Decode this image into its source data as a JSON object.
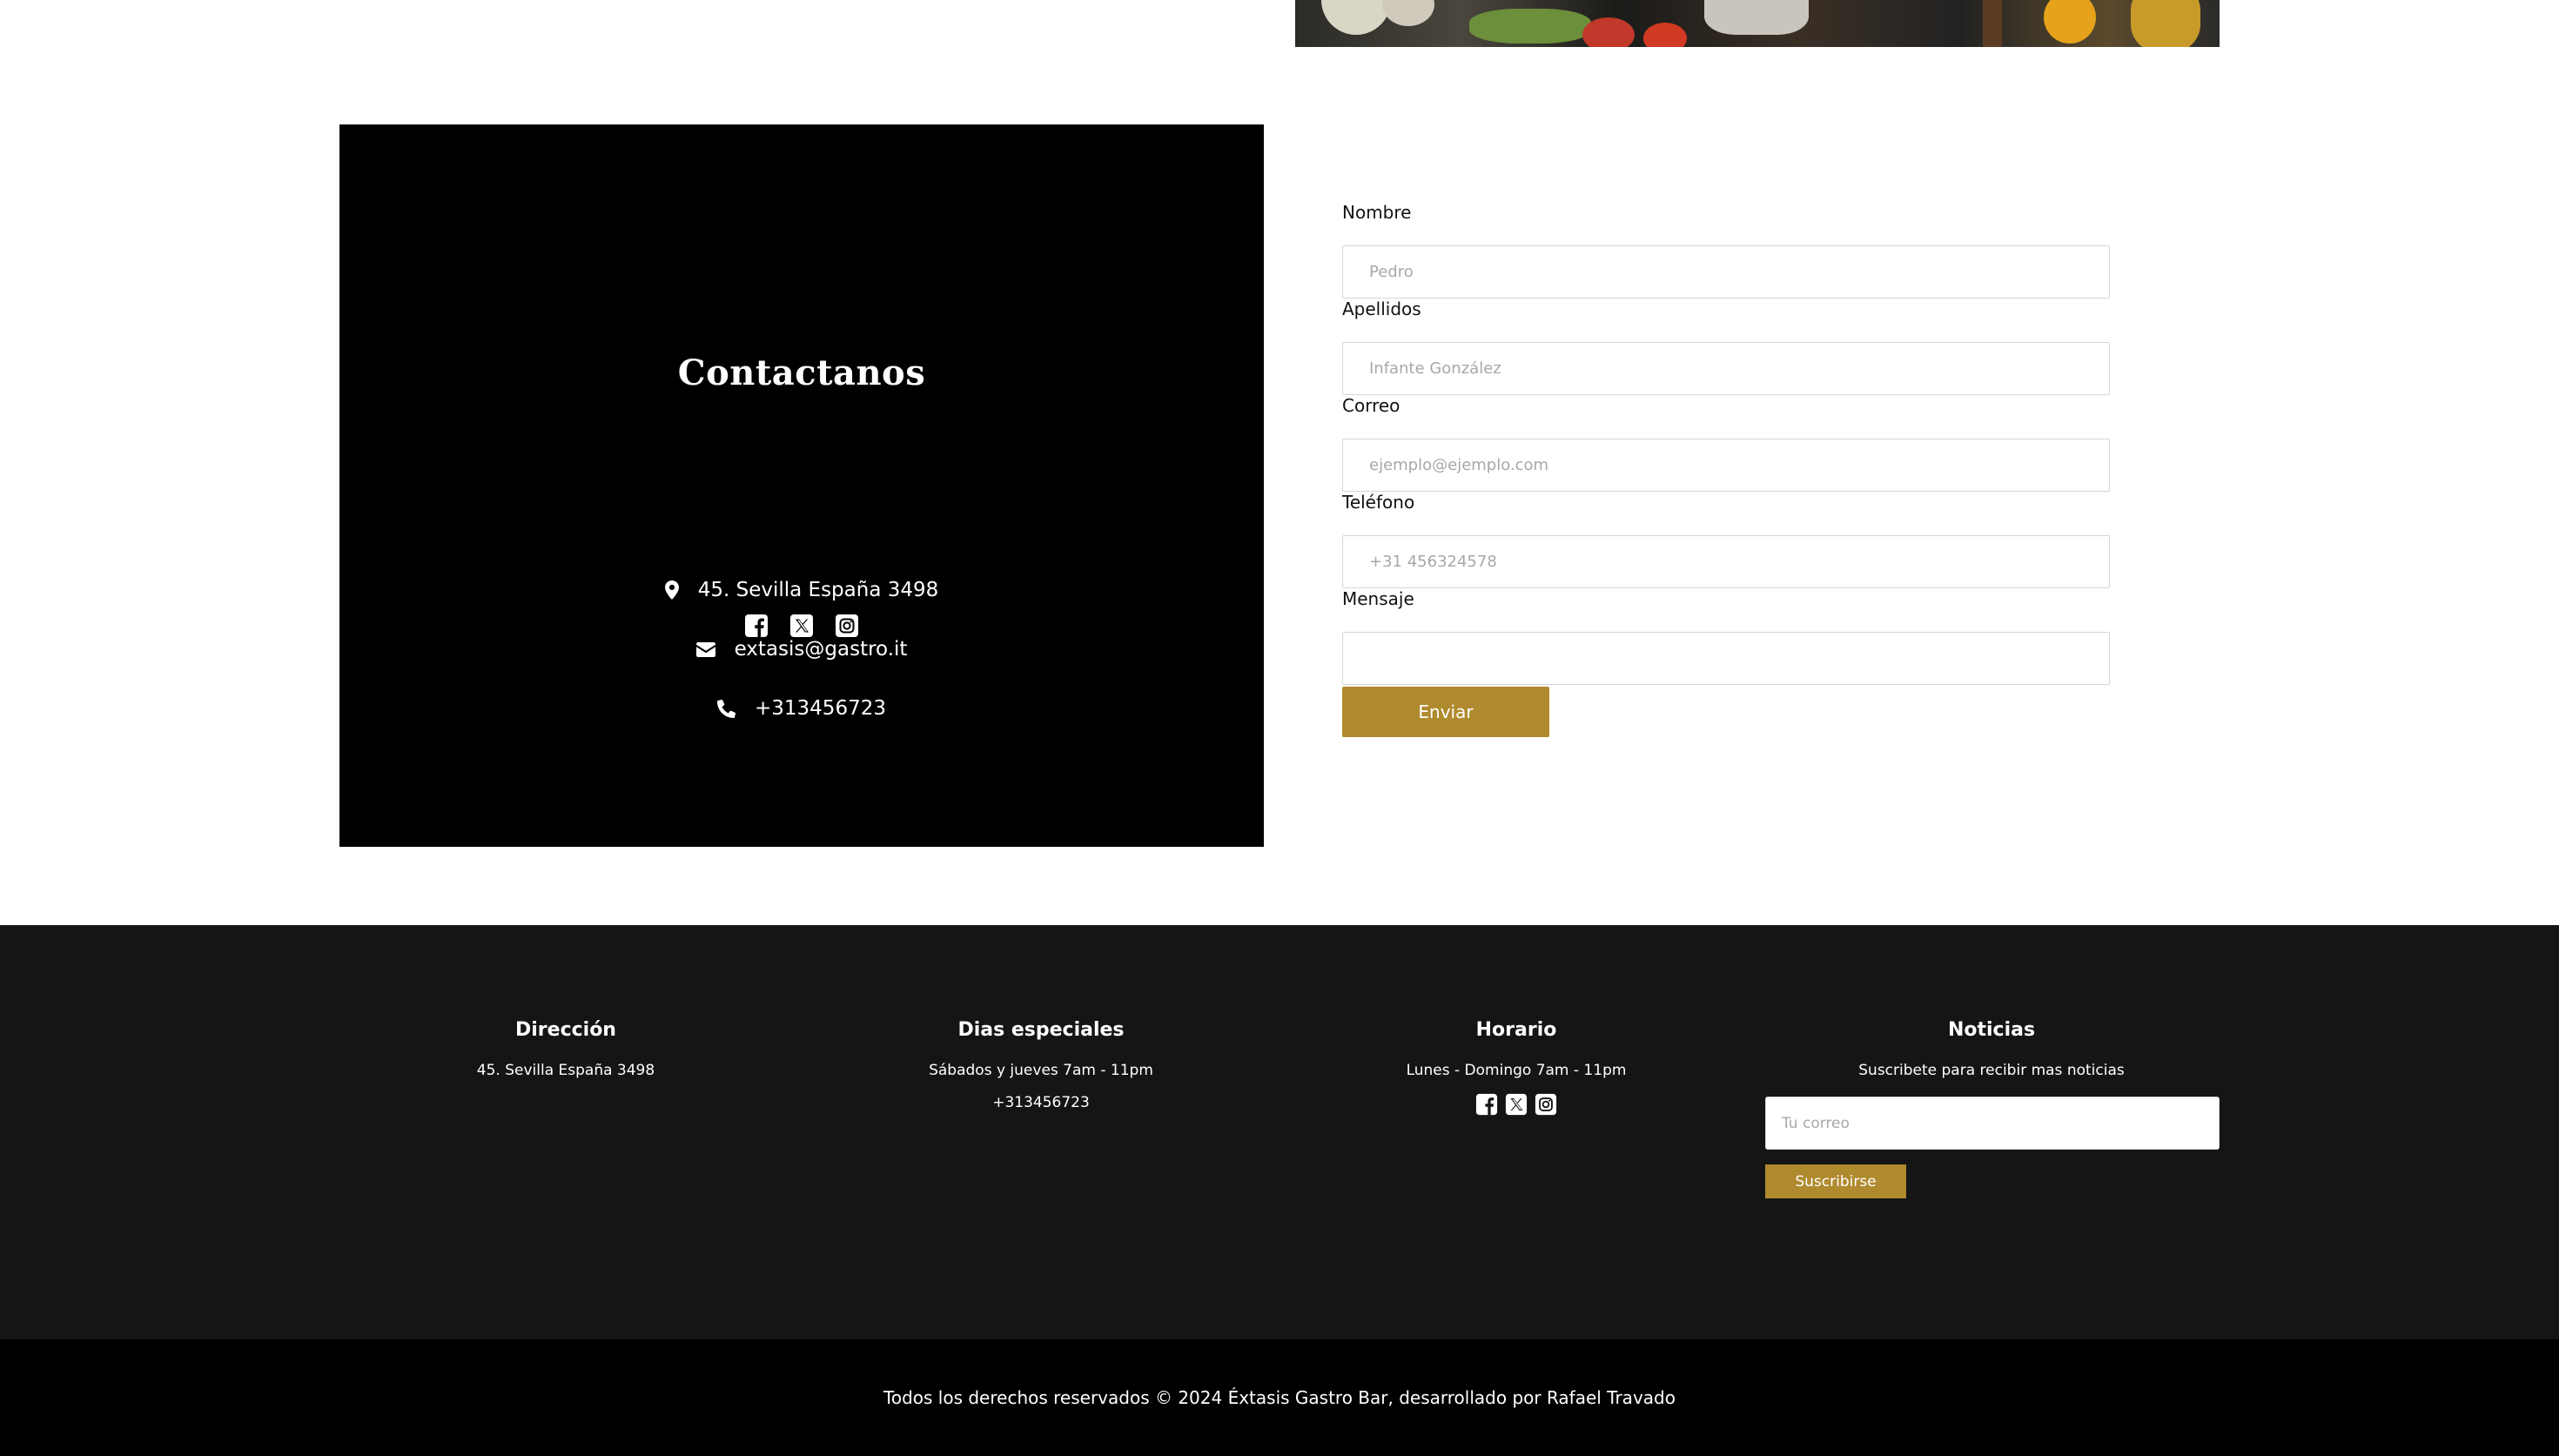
{
  "hero": {
    "alt_icon": "kitchen-photo"
  },
  "contact": {
    "title": "Contactanos",
    "address": "45. Sevilla España 3498",
    "email": "extasis@gastro.it",
    "phone": "+313456723",
    "icons": [
      "map-marker-icon",
      "envelope-icon",
      "phone-icon"
    ],
    "social_icons": [
      "facebook-icon",
      "x-icon",
      "instagram-icon"
    ]
  },
  "form": {
    "fields": [
      {
        "label": "Nombre",
        "placeholder": "Pedro"
      },
      {
        "label": "Apellidos",
        "placeholder": "Infante González"
      },
      {
        "label": "Correo",
        "placeholder": "ejemplo@ejemplo.com"
      },
      {
        "label": "Teléfono",
        "placeholder": "+31 456324578"
      },
      {
        "label": "Mensaje",
        "placeholder": ""
      }
    ],
    "submit_label": "Enviar"
  },
  "footer": {
    "columns": [
      {
        "title": "Dirección",
        "lines": [
          "45. Sevilla España 3498"
        ]
      },
      {
        "title": "Dias especiales",
        "lines": [
          "Sábados y jueves 7am - 11pm",
          "+313456723"
        ]
      },
      {
        "title": "Horario",
        "lines": [
          "Lunes - Domingo 7am - 11pm"
        ]
      },
      {
        "title": "Noticias",
        "lines": [
          "Suscribete para recibir mas noticias"
        ]
      }
    ],
    "newsletter_placeholder": "Tu correo",
    "subscribe_label": "Suscribirse"
  },
  "copyright": "Todos los derechos reservados © 2024 Éxtasis Gastro Bar, desarrollado por Rafael Travado",
  "colors": {
    "accent": "#b08a2e",
    "footer_bg": "#151515",
    "contact_bg": "#000000"
  }
}
